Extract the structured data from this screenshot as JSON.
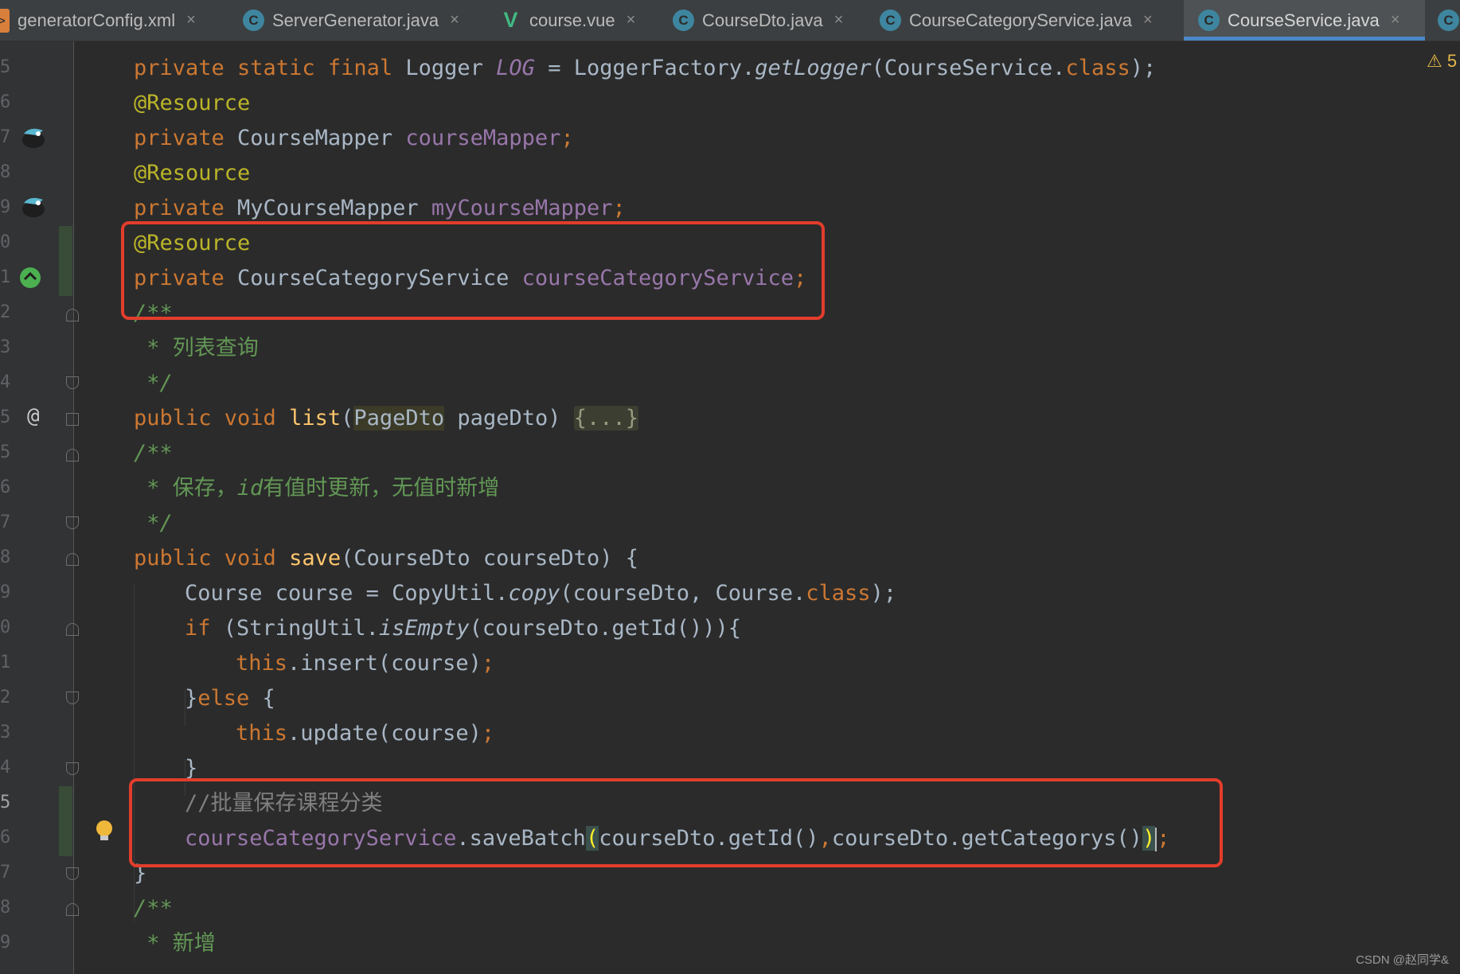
{
  "tabs": [
    {
      "label": "generatorConfig.xml",
      "icon": "xml-file-icon"
    },
    {
      "label": "ServerGenerator.java",
      "icon": "java-class-icon"
    },
    {
      "label": "course.vue",
      "icon": "vue-file-icon"
    },
    {
      "label": "CourseDto.java",
      "icon": "java-class-icon"
    },
    {
      "label": "CourseCategoryService.java",
      "icon": "java-class-icon"
    },
    {
      "label": "CourseService.java",
      "icon": "java-class-icon",
      "active": true
    }
  ],
  "tab_icon_letter": "C",
  "xml_icon_letter": ">",
  "vue_icon_letter": "V",
  "close_glyph": "×",
  "line_numbers": [
    "5",
    "6",
    "7",
    "8",
    "9",
    "0",
    "1",
    "2",
    "3",
    "4",
    "5",
    "5",
    "6",
    "7",
    "8",
    "9",
    "0",
    "1",
    "2",
    "3",
    "4",
    "5",
    "6",
    "7",
    "8",
    "9"
  ],
  "code": {
    "l1": {
      "kw": "private static final ",
      "t1": "Logger ",
      "fld": "LOG",
      "t2": " = LoggerFactory.",
      "m": "getLogger",
      "t3": "(CourseService.",
      "kw2": "class",
      "t4": ");"
    },
    "l2": {
      "ann": "@Resource"
    },
    "l3": {
      "kw": "private ",
      "t": "CourseMapper ",
      "fld": "courseMapper",
      "p": ";"
    },
    "l4": {
      "ann": "@Resource"
    },
    "l5": {
      "kw": "private ",
      "t": "MyCourseMapper ",
      "fld": "myCourseMapper",
      "p": ";"
    },
    "l6": {
      "ann": "@Resource"
    },
    "l7": {
      "kw": "private ",
      "t": "CourseCategoryService ",
      "fld": "courseCategoryService",
      "p": ";"
    },
    "l8": {
      "c": "/**"
    },
    "l9": {
      "c": " * 列表查询"
    },
    "l10": {
      "c": " */"
    },
    "l11": {
      "kw": "public void ",
      "fn": "list",
      "p1": "(",
      "type": "PageDto",
      "p2": " pageDto) ",
      "fold": "{...}"
    },
    "l12": {
      "c": "/**"
    },
    "l13": {
      "c1": " * 保存，",
      "ci": "id",
      "c2": "有值时更新，无值时新增"
    },
    "l14": {
      "c": " */"
    },
    "l15": {
      "kw": "public void ",
      "fn": "save",
      "t": "(CourseDto courseDto) {"
    },
    "l16": {
      "t1": "Course course = CopyUtil.",
      "m": "copy",
      "t2": "(courseDto, Course.",
      "kw": "class",
      "t3": ");"
    },
    "l17": {
      "kw": "if ",
      "t1": "(StringUtil.",
      "m": "isEmpty",
      "t2": "(courseDto.getId())){"
    },
    "l18": {
      "kw": "this",
      "t": ".insert(course)",
      "p": ";"
    },
    "l19": {
      "t": "}",
      "kw": "else ",
      "t2": "{"
    },
    "l20": {
      "kw": "this",
      "t": ".update(course)",
      "p": ";"
    },
    "l21": {
      "t": "}"
    },
    "l22": {
      "c": "//批量保存课程分类"
    },
    "l23": {
      "fld": "courseCategoryService",
      "t1": ".saveBatch",
      "b1": "(",
      "t2": "courseDto.getId()",
      "comma": ",",
      "t3": "courseDto.getCategorys()",
      "b2": ")",
      "p": ";"
    },
    "l24": {
      "t": "}"
    },
    "l25": {
      "c": "/**"
    },
    "l26": {
      "c": " * 新增"
    }
  },
  "warning_count": "5",
  "watermark": "CSDN @赵同学&",
  "colors": {
    "annotation_box": "#e23d2c",
    "active_tab_underline": "#4a88c7"
  }
}
